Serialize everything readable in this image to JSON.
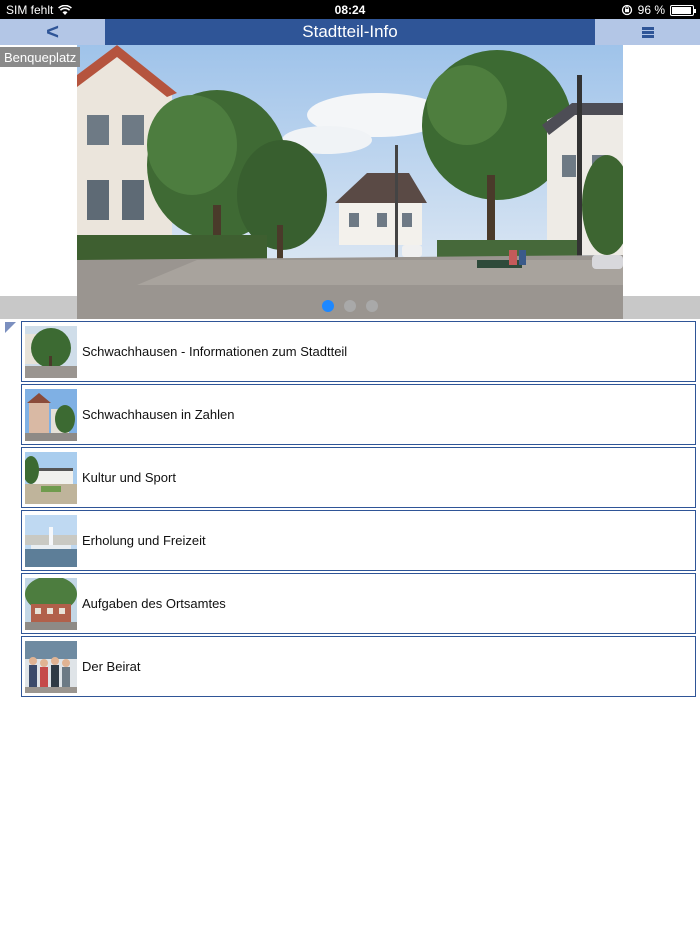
{
  "status_bar": {
    "carrier": "SIM fehlt",
    "time": "08:24",
    "battery_text": "96 %",
    "battery_level": 0.96,
    "icons": [
      "wifi-icon",
      "orientation-lock-icon",
      "battery-icon"
    ]
  },
  "nav": {
    "back_label": "<",
    "title": "Stadtteil-Info",
    "menu_icon": "hamburger-menu-icon"
  },
  "slider": {
    "caption": "Benqueplatz",
    "page_count": 3,
    "active_page": 1
  },
  "items": [
    {
      "label": "Schwachhausen - Informationen zum Stadtteil",
      "thumb_icon": "street-trees-thumbnail"
    },
    {
      "label": "Schwachhausen in Zahlen",
      "thumb_icon": "houses-thumbnail"
    },
    {
      "label": "Kultur und Sport",
      "thumb_icon": "building-park-thumbnail"
    },
    {
      "label": "Erholung und Freizeit",
      "thumb_icon": "fountain-thumbnail"
    },
    {
      "label": "Aufgaben des Ortsamtes",
      "thumb_icon": "town-hall-thumbnail"
    },
    {
      "label": "Der Beirat",
      "thumb_icon": "group-photo-thumbnail"
    }
  ],
  "colors": {
    "accent": "#2f5597",
    "nav_button_bg": "#b3c6e6",
    "dot_active": "#1e88ff",
    "dot_inactive": "#a9a9a9"
  }
}
